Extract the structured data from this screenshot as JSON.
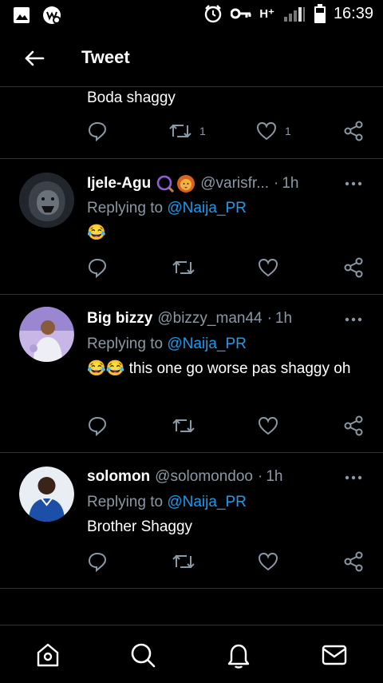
{
  "status_bar": {
    "time": "16:39",
    "network": "H⁺",
    "icons": [
      "gallery-icon",
      "app-badge-icon",
      "alarm-icon",
      "key-icon",
      "signal-icon",
      "battery-icon"
    ]
  },
  "header": {
    "title": "Tweet",
    "back_icon": "arrow-left-icon"
  },
  "tweets": [
    {
      "body": "Boda shaggy",
      "actions": {
        "retweet_count": "1",
        "like_count": "1"
      }
    },
    {
      "name": "Ijele-Agu",
      "name_emojis": [
        "magnifier-ring-icon",
        "lion-face-icon"
      ],
      "handle": "@varisfr...",
      "time": "1h",
      "replying_prefix": "Replying to",
      "replying_to": "@Naija_PR",
      "body": "😂",
      "avatar": "lion-avatar"
    },
    {
      "name": "Big bizzy",
      "handle": "@bizzy_man44",
      "time": "1h",
      "replying_prefix": "Replying to",
      "replying_to": "@Naija_PR",
      "body": "😂😂 this one go worse pas shaggy oh",
      "avatar": "person-avatar"
    },
    {
      "name": "solomon",
      "handle": "@solomondoo",
      "time": "1h",
      "replying_prefix": "Replying to",
      "replying_to": "@Naija_PR",
      "body": "Brother Shaggy",
      "avatar": "person-avatar"
    }
  ],
  "bottom_nav": [
    "home-icon",
    "search-icon",
    "notifications-icon",
    "messages-icon"
  ],
  "colors": {
    "background": "#000000",
    "text": "#ffffff",
    "secondary": "#8b98a5",
    "accent": "#1d9bf0",
    "divider": "#2f3336"
  }
}
